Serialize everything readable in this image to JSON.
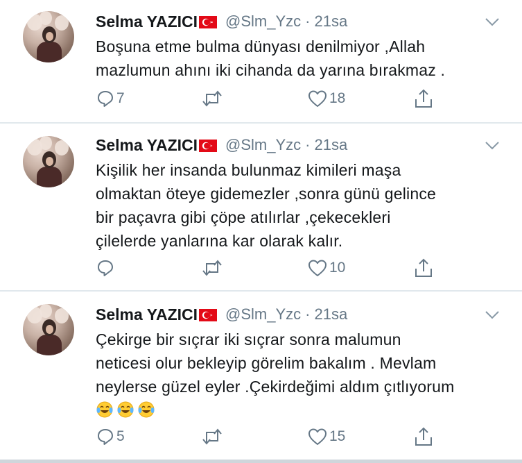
{
  "tweets": [
    {
      "name": "Selma YAZICI",
      "handle": "@Slm_Yzc",
      "separator": "·",
      "time": "21sa",
      "lines": [
        "Boşuna etme bulma dünyası denilmiyor ,Allah",
        "mazlumun ahını iki cihanda da yarına bırakmaz ."
      ],
      "replies": "7",
      "retweets": "",
      "likes": "18",
      "flag": "turkey-flag-emoji"
    },
    {
      "name": "Selma YAZICI",
      "handle": "@Slm_Yzc",
      "separator": "·",
      "time": "21sa",
      "lines": [
        "Kişilik her insanda bulunmaz kimileri maşa",
        "olmaktan öteye gidemezler ,sonra günü gelince",
        "bir paçavra gibi çöpe atılırlar ,çekecekleri",
        "çilelerde yanlarına kar olarak kalır."
      ],
      "replies": "",
      "retweets": "",
      "likes": "10",
      "flag": "turkey-flag-emoji"
    },
    {
      "name": "Selma YAZICI",
      "handle": "@Slm_Yzc",
      "separator": "·",
      "time": "21sa",
      "lines": [
        "Çekirge bir sıçrar iki sıçrar sonra malumun",
        "neticesi olur bekleyip görelim bakalım . Mevlam",
        "neylerse güzel eyler .Çekirdeğimi aldım çıtlıyorum"
      ],
      "emojis": [
        "tears-of-joy-emoji",
        "tears-of-joy-emoji",
        "tears-of-joy-emoji"
      ],
      "replies": "5",
      "retweets": "",
      "likes": "15",
      "flag": "turkey-flag-emoji"
    }
  ],
  "colors": {
    "text": "#14171a",
    "secondary": "#657786",
    "divider": "#e1e8ed",
    "flag_red": "#e30a17"
  },
  "icons": {
    "reply": "reply-icon",
    "retweet": "retweet-icon",
    "like": "heart-icon",
    "share": "share-icon",
    "caret": "chevron-down-icon"
  }
}
